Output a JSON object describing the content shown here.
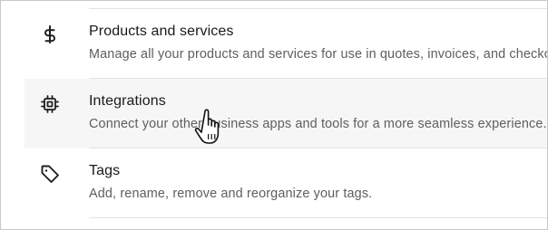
{
  "settings": {
    "items": [
      {
        "icon": "dollar-sign-icon",
        "title": "Products and services",
        "description": "Manage all your products and services for use in quotes, invoices, and checkouts."
      },
      {
        "icon": "integration-chip-icon",
        "title": "Integrations",
        "description": "Connect your other business apps and tools for a more seamless experience."
      },
      {
        "icon": "tag-icon",
        "title": "Tags",
        "description": "Add, rename, remove and reorganize your tags."
      }
    ]
  },
  "cursor": {
    "icon": "hand-pointer-cursor-icon"
  }
}
